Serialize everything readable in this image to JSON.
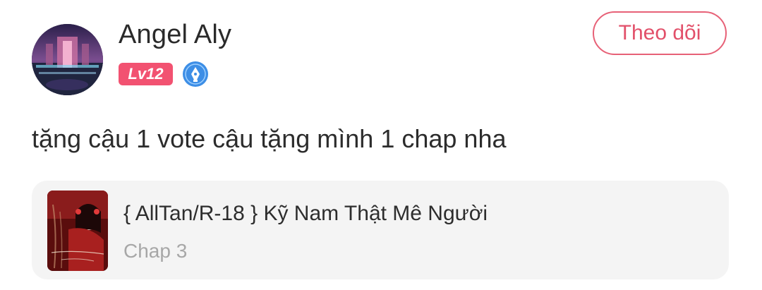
{
  "user": {
    "name": "Angel Aly",
    "level": "Lv12"
  },
  "follow_button": {
    "label": "Theo dõi"
  },
  "comment": {
    "text": "tặng cậu 1 vote cậu tặng mình 1 chap nha"
  },
  "story": {
    "title": "{ AllTan/R-18 } Kỹ Nam Thật Mê Người",
    "chapter": "Chap 3"
  },
  "colors": {
    "accent": "#e76177",
    "level_badge": "#f25271",
    "verify_icon": "#3d8ee6",
    "card_bg": "#f4f4f4",
    "secondary_text": "#a7a7a7"
  },
  "icons": {
    "verify": "pen-nib-badge-icon"
  }
}
